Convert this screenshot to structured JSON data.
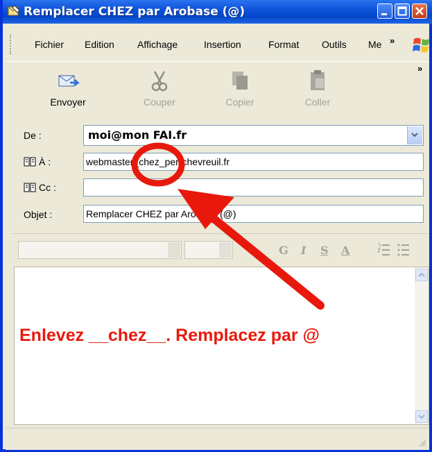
{
  "window": {
    "title": "Remplacer CHEZ par Arobase (@)"
  },
  "menu": {
    "items": [
      "Fichier",
      "Edition",
      "Affichage",
      "Insertion",
      "Format",
      "Outils",
      "Me"
    ],
    "overflow": "»"
  },
  "toolbar": {
    "send": "Envoyer",
    "cut": "Couper",
    "copy": "Copier",
    "paste": "Coller",
    "overflow": "»"
  },
  "header": {
    "from_label": "De :",
    "from_value": "moi@mon FAI.fr",
    "to_label": "À :",
    "to_value": "webmaster_chez_per-chevreuil.fr",
    "cc_label": "Cc :",
    "cc_value": "",
    "subject_label": "Objet :",
    "subject_value": "Remplacer CHEZ par Arobase (@)"
  },
  "format": {
    "bold": "G",
    "italic": "I",
    "underline": "S",
    "font_color": "A"
  },
  "annotation": {
    "text": "Enlevez __chez__. Remplacez par @",
    "color": "#e8190c"
  }
}
